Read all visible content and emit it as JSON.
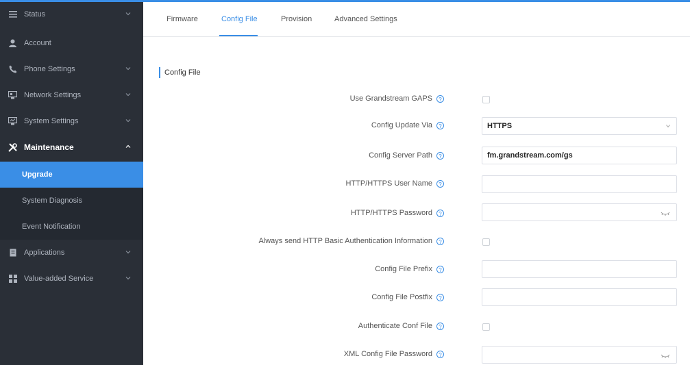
{
  "sidebar": {
    "items": [
      {
        "label": "Status",
        "icon": "list-icon"
      },
      {
        "label": "Account",
        "icon": "user-icon"
      },
      {
        "label": "Phone Settings",
        "icon": "phone-icon"
      },
      {
        "label": "Network Settings",
        "icon": "network-icon"
      },
      {
        "label": "System Settings",
        "icon": "system-icon"
      },
      {
        "label": "Maintenance",
        "icon": "tools-icon"
      },
      {
        "label": "Applications",
        "icon": "app-icon"
      },
      {
        "label": "Value-added Service",
        "icon": "grid-icon"
      }
    ],
    "sub_items": [
      {
        "label": "Upgrade"
      },
      {
        "label": "System Diagnosis"
      },
      {
        "label": "Event Notification"
      }
    ]
  },
  "tabs": [
    {
      "label": "Firmware"
    },
    {
      "label": "Config File"
    },
    {
      "label": "Provision"
    },
    {
      "label": "Advanced Settings"
    }
  ],
  "section": {
    "title": "Config File"
  },
  "form": {
    "use_gaps": {
      "label": "Use Grandstream GAPS"
    },
    "update_via": {
      "label": "Config Update Via",
      "value": "HTTPS"
    },
    "server_path": {
      "label": "Config Server Path",
      "value": "fm.grandstream.com/gs"
    },
    "user_name": {
      "label": "HTTP/HTTPS User Name",
      "value": ""
    },
    "password": {
      "label": "HTTP/HTTPS Password",
      "value": ""
    },
    "always_send": {
      "label": "Always send HTTP Basic Authentication Information"
    },
    "prefix": {
      "label": "Config File Prefix",
      "value": ""
    },
    "postfix": {
      "label": "Config File Postfix",
      "value": ""
    },
    "auth_conf": {
      "label": "Authenticate Conf File"
    },
    "xml_password": {
      "label": "XML Config File Password",
      "value": ""
    }
  },
  "colors": {
    "accent": "#3a8ee6",
    "sidebar": "#2a2f37"
  }
}
